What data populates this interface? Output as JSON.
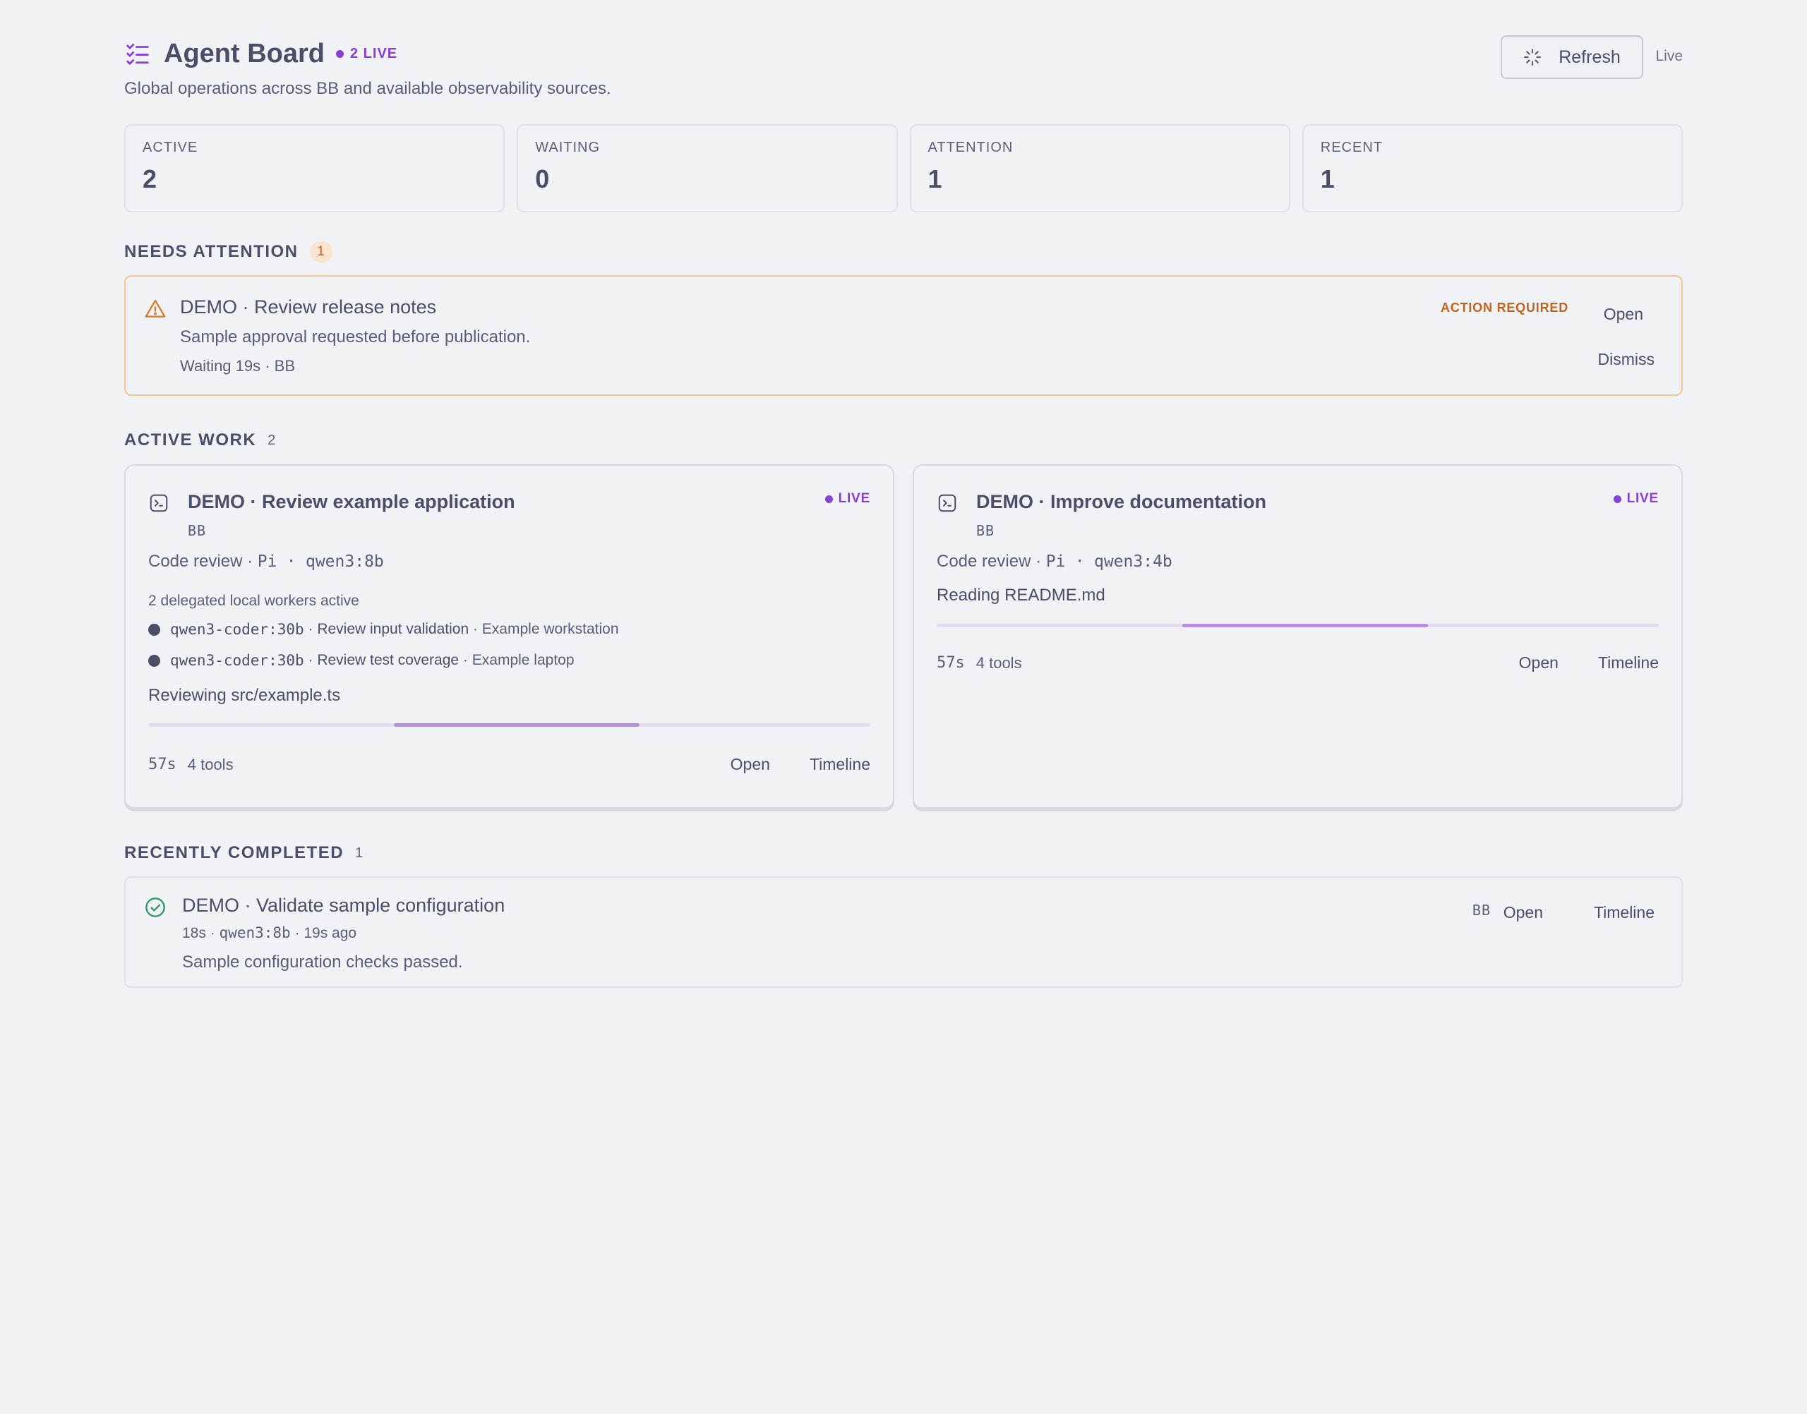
{
  "header": {
    "title": "Agent Board",
    "live_badge": "2 LIVE",
    "subtitle": "Global operations across BB and available observability sources.",
    "refresh_label": "Refresh",
    "live_label": "Live",
    "accent_color": "#8a3fd6"
  },
  "stats": [
    {
      "label": "ACTIVE",
      "value": "2"
    },
    {
      "label": "WAITING",
      "value": "0"
    },
    {
      "label": "ATTENTION",
      "value": "1"
    },
    {
      "label": "RECENT",
      "value": "1"
    }
  ],
  "needs_attention": {
    "title": "NEEDS ATTENTION",
    "count": "1",
    "items": [
      {
        "title": "DEMO · Review release notes",
        "description": "Sample approval requested before publication.",
        "meta": "Waiting 19s · BB",
        "status": "ACTION REQUIRED",
        "open_label": "Open",
        "dismiss_label": "Dismiss",
        "icon": "warning-icon"
      }
    ]
  },
  "active_work": {
    "title": "ACTIVE WORK",
    "count": "2",
    "cards": [
      {
        "title": "DEMO · Review example application",
        "host": "BB",
        "live": "LIVE",
        "kind": "Code review",
        "agent": "Pi",
        "separator": "·",
        "model": "qwen3:8b",
        "workers_heading": "2 delegated local workers active",
        "workers": [
          {
            "model": "qwen3-coder:30b",
            "task": "Review input validation",
            "machine": "Example workstation"
          },
          {
            "model": "qwen3-coder:30b",
            "task": "Review test coverage",
            "machine": "Example laptop"
          }
        ],
        "activity": "Reviewing src/example.ts",
        "progress": {
          "start": 0.34,
          "end": 0.68
        },
        "duration": "57s",
        "tools": "4 tools",
        "open_label": "Open",
        "timeline_label": "Timeline",
        "icon": "terminal-icon"
      },
      {
        "title": "DEMO · Improve documentation",
        "host": "BB",
        "live": "LIVE",
        "kind": "Code review",
        "agent": "Pi",
        "separator": "·",
        "model": "qwen3:4b",
        "activity": "Reading README.md",
        "progress": {
          "start": 0.34,
          "end": 0.68
        },
        "duration": "57s",
        "tools": "4 tools",
        "open_label": "Open",
        "timeline_label": "Timeline",
        "icon": "terminal-icon"
      }
    ]
  },
  "recently_completed": {
    "title": "RECENTLY COMPLETED",
    "count": "1",
    "items": [
      {
        "title": "DEMO · Validate sample configuration",
        "duration": "18s",
        "model": "qwen3:8b",
        "ago": "19s ago",
        "summary": "Sample configuration checks passed.",
        "host": "BB",
        "open_label": "Open",
        "timeline_label": "Timeline",
        "icon": "check-circle-icon"
      }
    ]
  }
}
